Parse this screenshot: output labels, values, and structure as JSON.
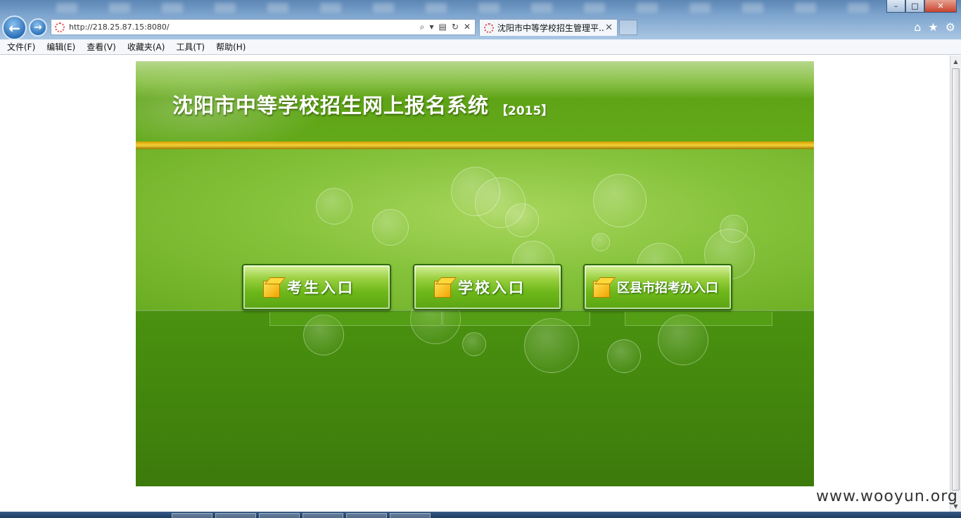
{
  "browser": {
    "url": "http://218.25.87.15:8080/",
    "tab_title": "沈阳市中等学校招生管理平...",
    "window_buttons": {
      "minimize": "–",
      "maximize": "□",
      "close": "✕"
    }
  },
  "menu": {
    "items": [
      {
        "label": "文件(F)"
      },
      {
        "label": "编辑(E)"
      },
      {
        "label": "查看(V)"
      },
      {
        "label": "收藏夹(A)"
      },
      {
        "label": "工具(T)"
      },
      {
        "label": "帮助(H)"
      }
    ]
  },
  "banner": {
    "title": "沈阳市中等学校招生网上报名系统",
    "year": "【2015】"
  },
  "entries": [
    {
      "label": "考生入口"
    },
    {
      "label": "学校入口"
    },
    {
      "label": "区县市招考办入口"
    }
  ],
  "watermark": "www.wooyun.org",
  "icons": [
    "back-icon",
    "forward-icon",
    "search-icon",
    "refresh-icon",
    "stop-icon",
    "home-icon",
    "favorites-star-icon",
    "settings-gear-icon",
    "box-icon"
  ]
}
